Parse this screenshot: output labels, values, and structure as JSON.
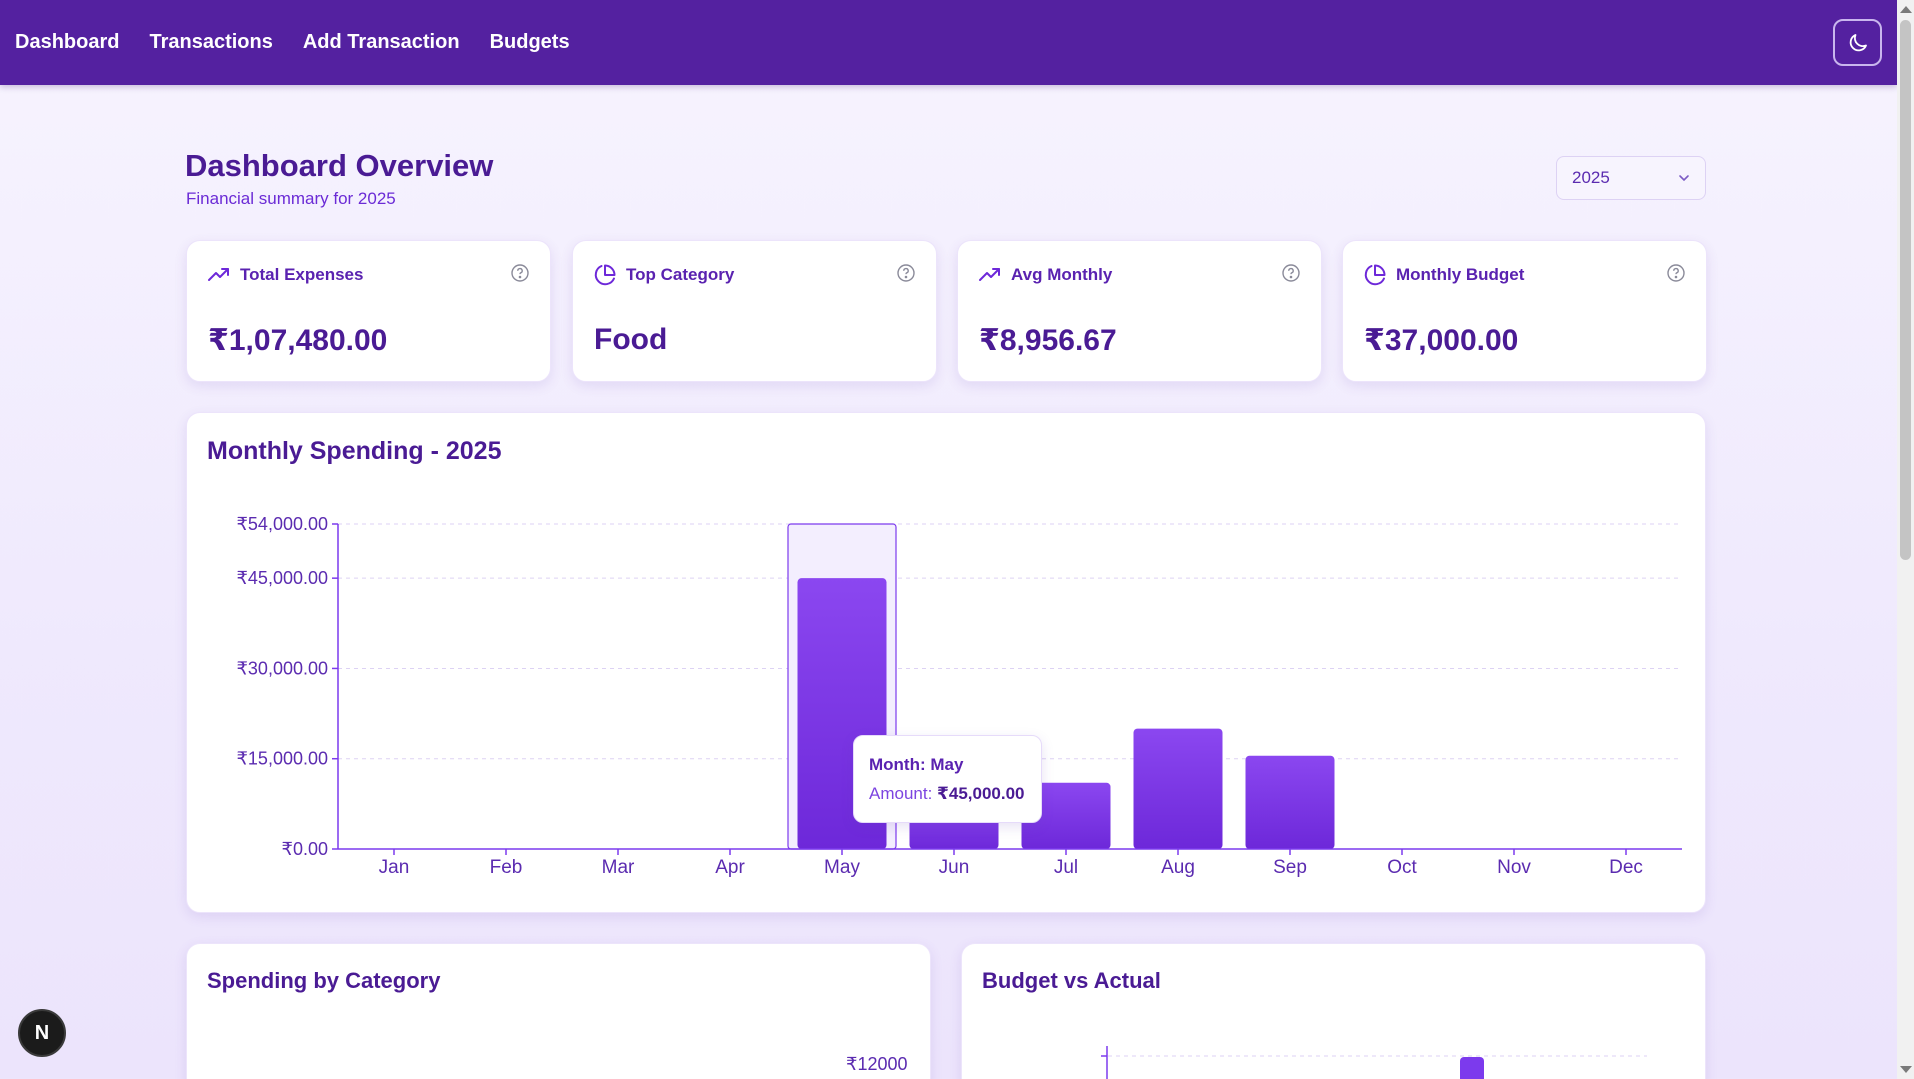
{
  "nav": {
    "links": [
      "Dashboard",
      "Transactions",
      "Add Transaction",
      "Budgets"
    ]
  },
  "header": {
    "title": "Dashboard Overview",
    "subtitle": "Financial summary for 2025",
    "year_selected": "2025"
  },
  "stats": [
    {
      "label": "Total Expenses",
      "value": "₹1,07,480.00",
      "icon": "trending-up-icon"
    },
    {
      "label": "Top Category",
      "value": "Food",
      "icon": "pie-chart-icon"
    },
    {
      "label": "Avg Monthly",
      "value": "₹8,956.67",
      "icon": "trending-up-icon"
    },
    {
      "label": "Monthly Budget",
      "value": "₹37,000.00",
      "icon": "pie-chart-icon"
    }
  ],
  "monthly_chart": {
    "title": "Monthly Spending - 2025"
  },
  "tooltip": {
    "month_text": "Month: May",
    "amount_label": "Amount:",
    "amount_value": "₹45,000.00"
  },
  "bottom": {
    "category_title": "Spending by Category",
    "budget_title": "Budget vs Actual",
    "budget_axis_top": "₹12000"
  },
  "colors": {
    "nav": "#5421a0",
    "bar": "#7c3aed",
    "title": "#4a1b94"
  },
  "chart_data": {
    "type": "bar",
    "title": "Monthly Spending - 2025",
    "categories": [
      "Jan",
      "Feb",
      "Mar",
      "Apr",
      "May",
      "Jun",
      "Jul",
      "Aug",
      "Sep",
      "Oct",
      "Nov",
      "Dec"
    ],
    "values": [
      0,
      0,
      0,
      0,
      45000,
      7800,
      11000,
      20000,
      15500,
      0,
      0,
      0
    ],
    "yticks": [
      "₹0.00",
      "₹15,000.00",
      "₹30,000.00",
      "₹45,000.00",
      "₹54,000.00"
    ],
    "ytick_values": [
      0,
      15000,
      30000,
      45000,
      54000
    ],
    "ylim": [
      0,
      54000
    ],
    "grid": true,
    "highlighted": "May"
  }
}
